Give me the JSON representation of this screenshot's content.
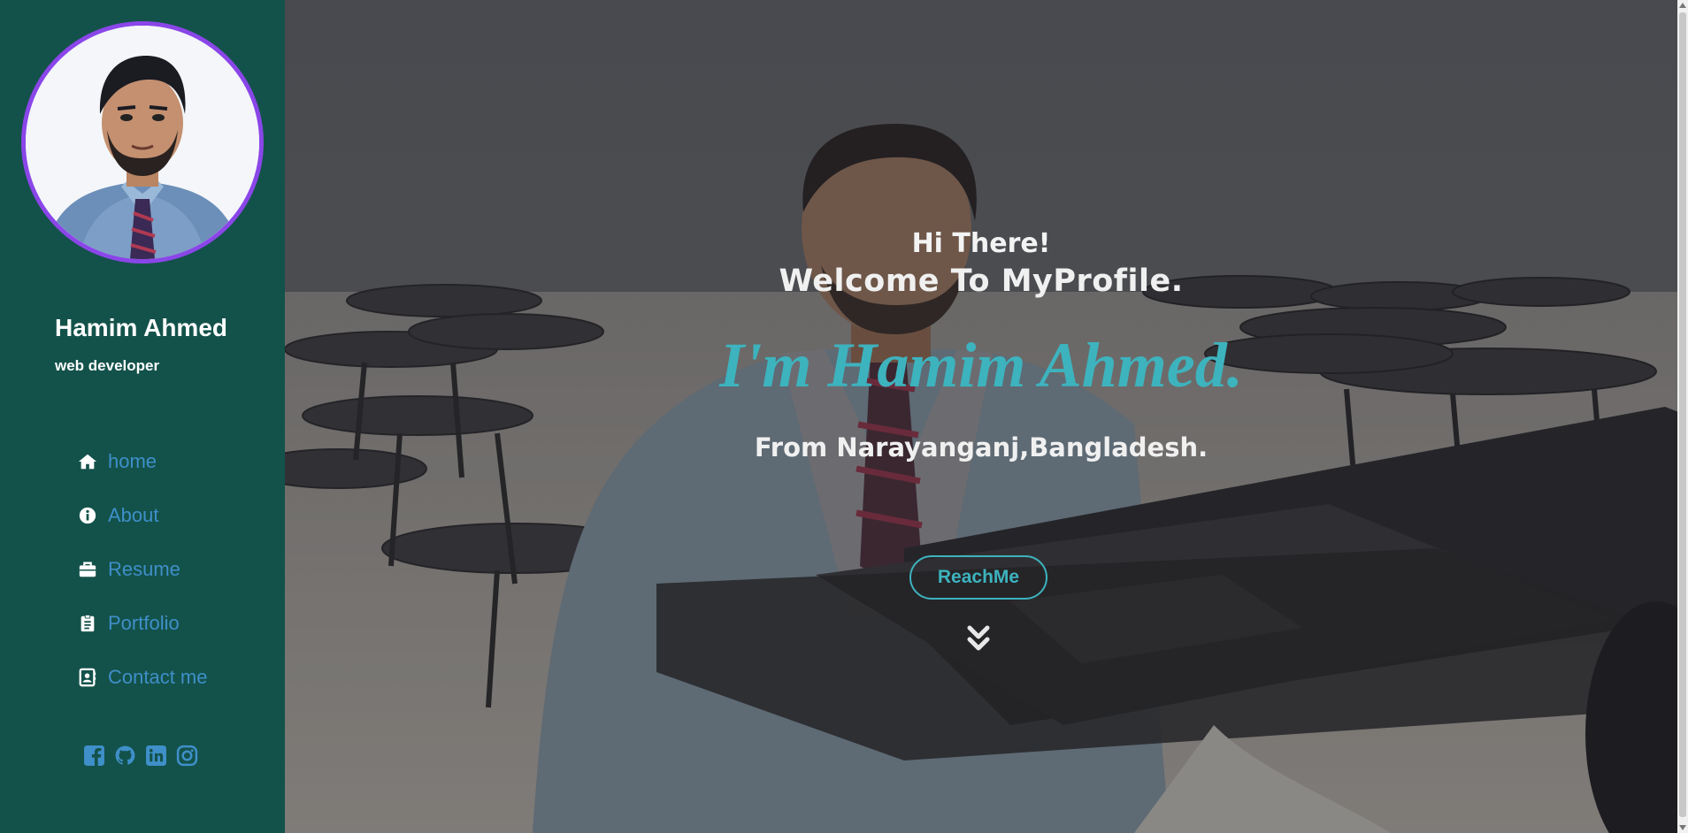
{
  "sidebar": {
    "name": "Hamim Ahmed",
    "role": "web developer",
    "avatar_icon": "profile-photo",
    "nav": [
      {
        "label": "home",
        "icon": "home-icon"
      },
      {
        "label": "About",
        "icon": "info-icon"
      },
      {
        "label": "Resume",
        "icon": "briefcase-icon"
      },
      {
        "label": "Portfolio",
        "icon": "clipboard-icon"
      },
      {
        "label": "Contact me",
        "icon": "contact-icon"
      }
    ],
    "social": [
      "facebook-icon",
      "github-icon",
      "linkedin-icon",
      "instagram-icon"
    ]
  },
  "hero": {
    "greeting": "Hi There!",
    "welcome": "Welcome To MyProfile.",
    "headline": "I'm Hamim Ahmed.",
    "location": "From Narayanganj,Bangladesh.",
    "cta_label": "ReachMe",
    "scroll_icon": "chevron-double-down-icon"
  },
  "colors": {
    "sidebar_bg": "#13524a",
    "accent_teal": "#3db3be",
    "link_blue": "#3f8fc9",
    "avatar_border": "#8a46e8"
  }
}
